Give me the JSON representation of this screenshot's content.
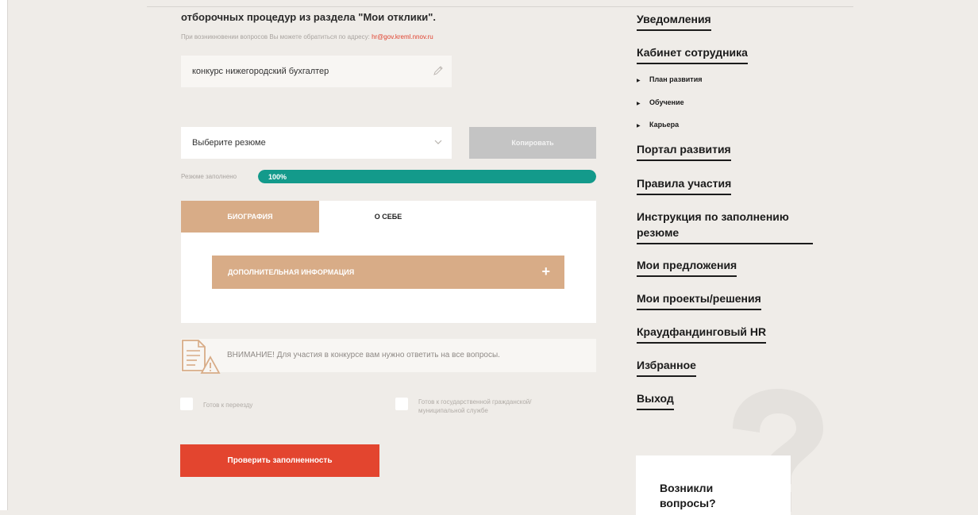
{
  "intro": {
    "text": "отборочных процедур из раздела ",
    "section_name": "\"Мои отклики\"",
    "period": "."
  },
  "contact": {
    "text": "При возникновении вопросов Вы можете обратиться по адресу: ",
    "email": "hr@gov.kreml.nnov.ru"
  },
  "search": {
    "value": "конкурс нижегородский бухгалтер",
    "icon": "pencil-icon"
  },
  "resume_select": {
    "selected": "Выберите резюме",
    "icon": "chevron-down-icon"
  },
  "copy_button": {
    "label": "Копировать"
  },
  "progress": {
    "label": "Резюме заполнено",
    "value_text": "100%",
    "percent": 100,
    "color": "#139a8b"
  },
  "tabs": [
    {
      "label": "БИОГРАФИЯ",
      "active": true
    },
    {
      "label": "О СЕБЕ",
      "active": false
    }
  ],
  "accordion": {
    "label": "ДОПОЛНИТЕЛЬНАЯ ИНФОРМАЦИЯ",
    "icon": "+"
  },
  "warning": {
    "text": "ВНИМАНИЕ! Для участия в конкурсе вам нужно ответить на все вопросы.",
    "icon": "document-warning-icon"
  },
  "checkboxes": [
    {
      "label": "Готов к переезду",
      "checked": false
    },
    {
      "label": "Готов к государственной гражданской/муниципальной службе",
      "checked": false
    }
  ],
  "verify_button": {
    "label": "Проверить заполненность"
  },
  "sidebar": {
    "links": [
      "Уведомления",
      "Кабинет сотрудника",
      "Портал развития",
      "Правила участия",
      "Инструкция по заполнению резюме",
      "Мои предложения",
      "Мои проекты/решения",
      "Краудфандинговый HR",
      "Избранное",
      "Выход"
    ],
    "sub_items": [
      "План развития",
      "Обучение",
      "Карьера"
    ]
  },
  "help": {
    "line1": "Возникли",
    "line2": "вопросы?"
  },
  "colors": {
    "accent": "#d8ac87",
    "primary_button": "#e3452f",
    "disabled_button": "#c4c4c4",
    "background": "#efece8"
  }
}
